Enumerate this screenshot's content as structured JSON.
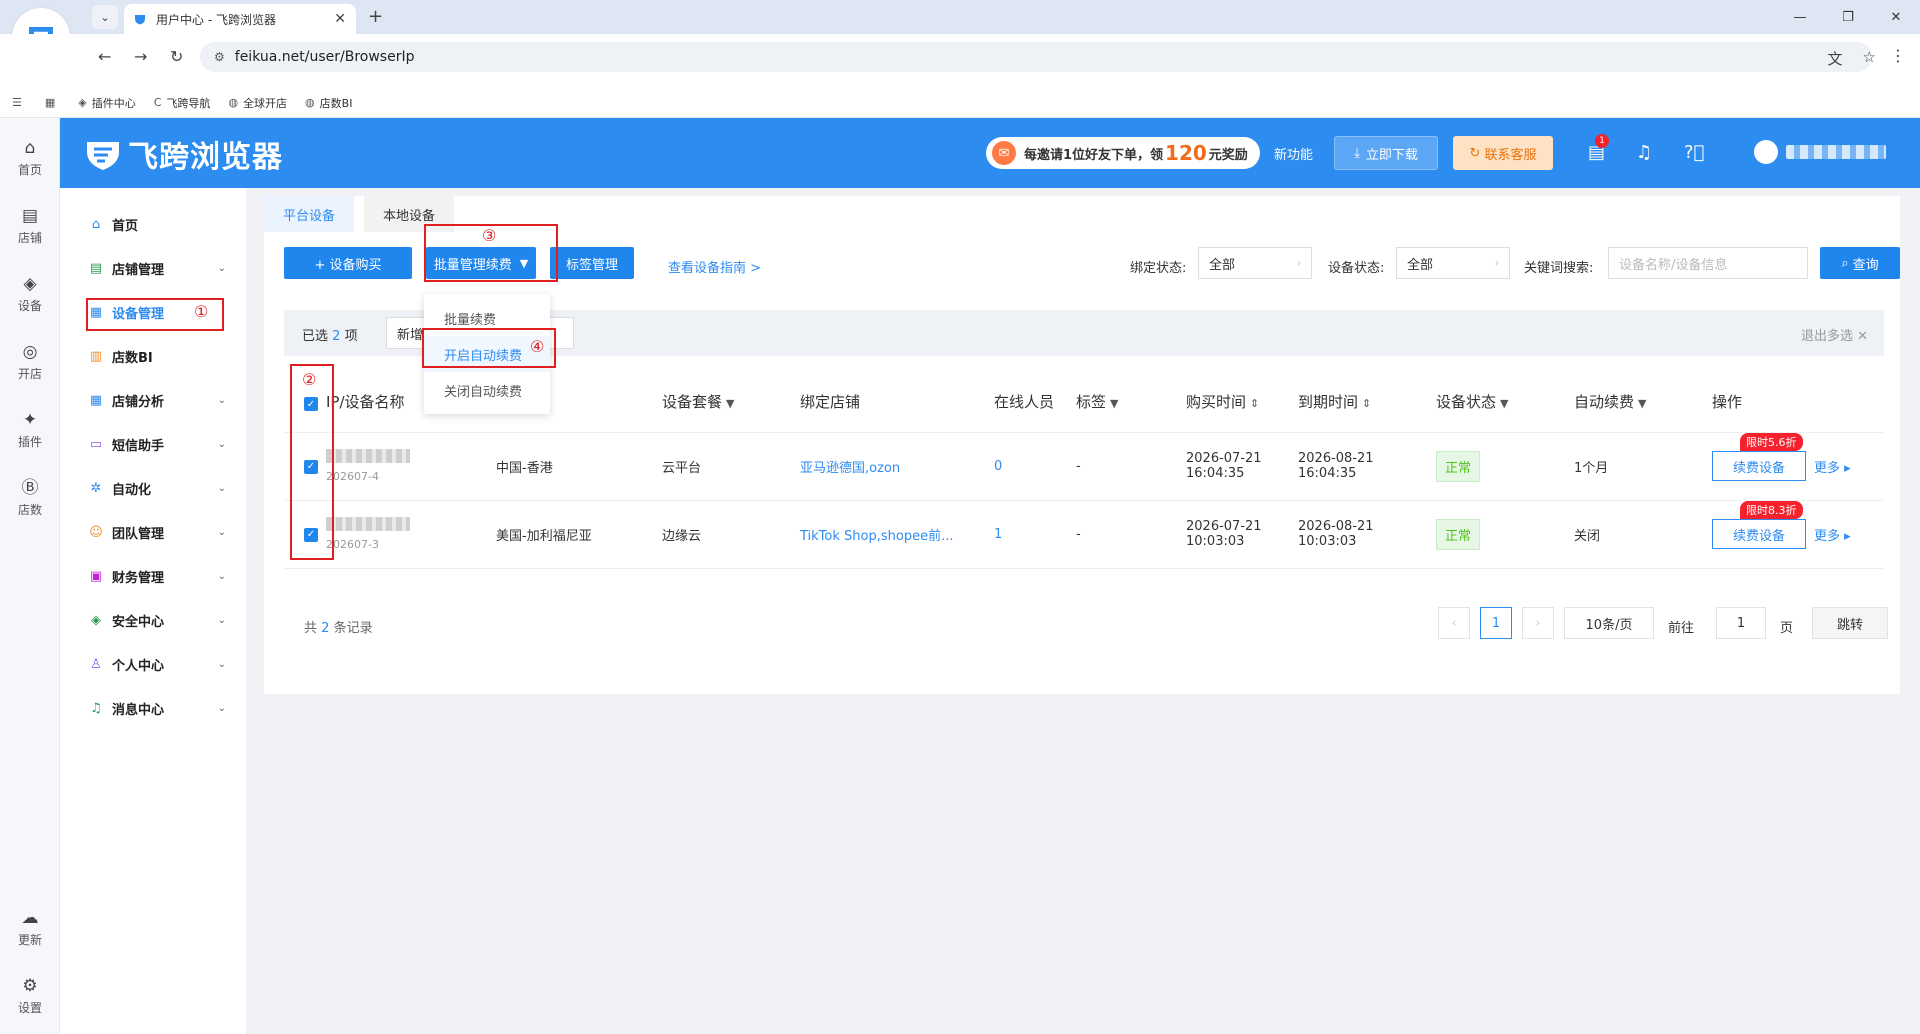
{
  "browser": {
    "tab_title": "用户中心 - 飞跨浏览器",
    "url": "feikua.net/user/BrowserIp",
    "bookmarks": [
      "插件中心",
      "飞跨导航",
      "全球开店",
      "店数BI"
    ]
  },
  "rail": [
    "首页",
    "店铺",
    "设备",
    "开店",
    "插件",
    "店数",
    "更新",
    "设置"
  ],
  "header": {
    "brand": "飞跨浏览器",
    "promo_prefix": "每邀请1位好友下单，领",
    "promo_amount": "120",
    "promo_suffix": "元奖励",
    "new_features": "新功能",
    "download": "立即下载",
    "support": "联系客服",
    "notifications": "1"
  },
  "menu": [
    {
      "label": "首页",
      "icon": "home-icon"
    },
    {
      "label": "店铺管理",
      "icon": "store-icon"
    },
    {
      "label": "设备管理",
      "icon": "device-icon"
    },
    {
      "label": "店数BI",
      "icon": "chart-icon"
    },
    {
      "label": "店铺分析",
      "icon": "analysis-icon"
    },
    {
      "label": "短信助手",
      "icon": "sms-icon"
    },
    {
      "label": "自动化",
      "icon": "automation-icon"
    },
    {
      "label": "团队管理",
      "icon": "team-icon"
    },
    {
      "label": "财务管理",
      "icon": "wallet-icon"
    },
    {
      "label": "安全中心",
      "icon": "shield-icon"
    },
    {
      "label": "个人中心",
      "icon": "user-icon"
    },
    {
      "label": "消息中心",
      "icon": "bell-icon"
    }
  ],
  "tabs": [
    "平台设备",
    "本地设备"
  ],
  "actions": {
    "buy": "+ 设备购买",
    "batch": "批量管理续费",
    "tags": "标签管理",
    "guide": "查看设备指南 >"
  },
  "filters": {
    "bind_label": "绑定状态:",
    "bind_value": "全部",
    "status_label": "设备状态:",
    "status_value": "全部",
    "keyword_label": "关键词搜索:",
    "keyword_placeholder": "设备名称/设备信息",
    "search": "查询"
  },
  "selection": {
    "prefix": "已选",
    "count": "2",
    "suffix": "项",
    "add": "新增",
    "tag": "标签",
    "exit": "退出多选 ✕"
  },
  "dropdown": [
    "批量续费",
    "开启自动续费",
    "关闭自动续费"
  ],
  "columns": [
    "IP/设备名称",
    "设备套餐",
    "绑定店铺",
    "在线人员",
    "标签",
    "购买时间",
    "到期时间",
    "设备状态",
    "自动续费",
    "操作"
  ],
  "rows": [
    {
      "ip": "",
      "id": "202607-4",
      "region": "中国-香港",
      "plan": "云平台",
      "shop": "亚马逊德国,ozon",
      "online": "0",
      "tag": "-",
      "buy_date": "2026-07-21",
      "buy_time": "16:04:35",
      "exp_date": "2026-08-21",
      "exp_time": "16:04:35",
      "status": "正常",
      "auto": "1个月",
      "discount": "限时5.6折",
      "renew": "续费设备",
      "more": "更多"
    },
    {
      "ip": "",
      "id": "202607-3",
      "region": "美国-加利福尼亚",
      "plan": "边缘云",
      "shop": "TikTok Shop,shopee前...",
      "online": "1",
      "tag": "-",
      "buy_date": "2026-07-21",
      "buy_time": "10:03:03",
      "exp_date": "2026-08-21",
      "exp_time": "10:03:03",
      "status": "正常",
      "auto": "关闭",
      "discount": "限时8.3折",
      "renew": "续费设备",
      "more": "更多"
    }
  ],
  "pager": {
    "total_prefix": "共",
    "total": "2",
    "total_suffix": "条记录",
    "page": "1",
    "size": "10条/页",
    "goto_label": "前往",
    "goto_value": "1",
    "page_unit": "页",
    "jump": "跳转"
  },
  "annotations": [
    "①",
    "②",
    "③",
    "④"
  ],
  "colors": {
    "primary": "#2d8cf0",
    "annotation": "#e02020",
    "success": "#52c41a"
  }
}
